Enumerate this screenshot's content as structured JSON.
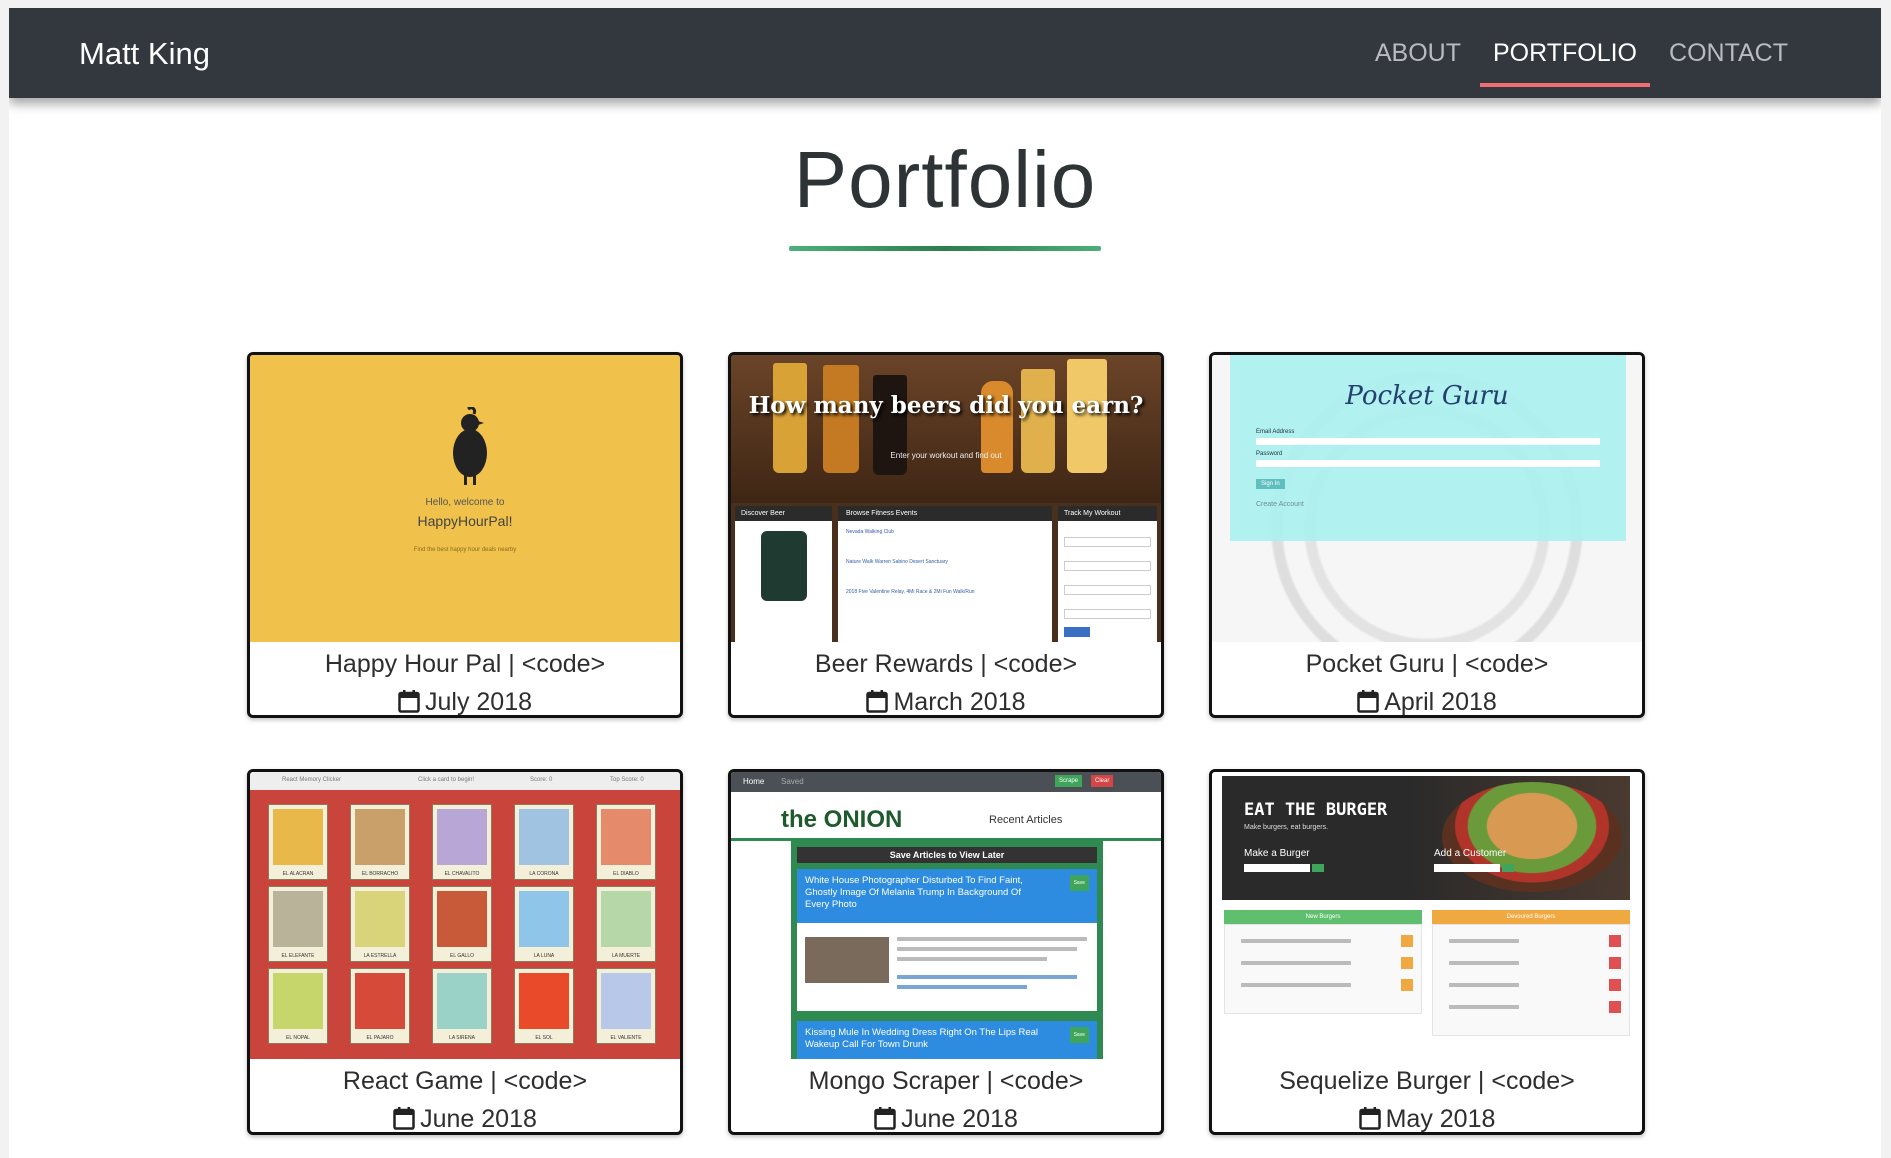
{
  "nav": {
    "brand": "Matt King",
    "links": [
      "ABOUT",
      "PORTFOLIO",
      "CONTACT"
    ],
    "active": "PORTFOLIO",
    "accent": "#ee6e73"
  },
  "page": {
    "title": "Portfolio"
  },
  "cards": [
    {
      "title": "Happy Hour Pal | <code>",
      "date": "July 2018",
      "thumb": {
        "greeting": "Hello, welcome to",
        "app": "HappyHourPal!",
        "tagline": "Find the best happy hour deals nearby",
        "bg": "#f0c14b"
      }
    },
    {
      "title": "Beer Rewards | <code>",
      "date": "March 2018",
      "thumb": {
        "headline": "How many beers did you earn?",
        "sub": "Enter your workout and find out",
        "panels": [
          "Discover Beer",
          "Browse Fitness Events",
          "Track My Workout"
        ],
        "events": [
          "Nevada Walking Club",
          "Nature Walk Warren Sabino Desert Sanctuary",
          "2018 Five Valentine Relay, 4Mi Race & 2Mi Fun Walk/Run"
        ]
      }
    },
    {
      "title": "Pocket Guru | <code>",
      "date": "April 2018",
      "thumb": {
        "app": "Pocket Guru",
        "email_label": "Email Address",
        "password_label": "Password",
        "signin": "Sign In",
        "create": "Create Account",
        "bg": "#aaf0ef"
      }
    },
    {
      "title": "React Game | <code>",
      "date": "June 2018",
      "thumb": {
        "header": [
          "React Memory Clicker",
          "Click a card to begin!",
          "Score: 0",
          "Top Score: 0"
        ],
        "cards": [
          "EL ALACRAN",
          "EL BORRACHO",
          "EL CHAVALITO",
          "LA CORONA",
          "EL DIABLO",
          "EL ELEFANTE",
          "LA ESTRELLA",
          "EL GALLO",
          "LA LUNA",
          "LA MUERTE",
          "EL NOPAL",
          "EL PAJARO",
          "LA SIRENA",
          "EL SOL",
          "EL VALIENTE"
        ]
      }
    },
    {
      "title": "Mongo Scraper | <code>",
      "date": "June 2018",
      "thumb": {
        "nav": [
          "Home",
          "Saved"
        ],
        "buttons": [
          "Scrape",
          "Clear"
        ],
        "logo": "the ONION",
        "recent": "Recent Articles",
        "panel": "Save Articles to View Later",
        "article1": "White House Photographer Disturbed To Find Faint, Ghostly Image Of Melania Trump In Background Of Every Photo",
        "article2": "Kissing Mule In Wedding Dress Right On The Lips Real Wakeup Call For Town Drunk",
        "save": "Save"
      }
    },
    {
      "title": "Sequelize Burger | <code>",
      "date": "May 2018",
      "thumb": {
        "headline": "EAT THE BURGER",
        "tag": "Make burgers, eat burgers.",
        "make": "Make a Burger",
        "add": "Add a Customer",
        "new_col": "New Burgers",
        "devoured_col": "Devoured Burgers"
      }
    }
  ]
}
